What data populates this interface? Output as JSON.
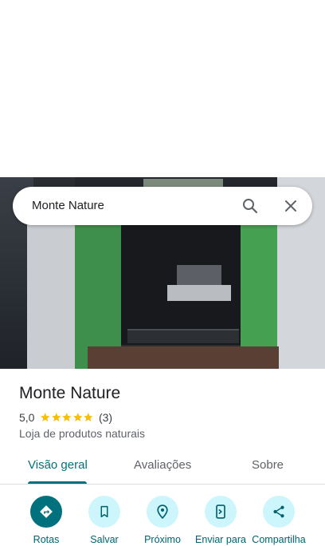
{
  "search": {
    "query": "Monte Nature"
  },
  "place": {
    "name": "Monte Nature",
    "rating": "5,0",
    "stars": 5,
    "review_count": "(3)",
    "category": "Loja de produtos naturais"
  },
  "tabs": [
    {
      "label": "Visão geral"
    },
    {
      "label": "Avaliações"
    },
    {
      "label": "Sobre"
    }
  ],
  "actions": [
    {
      "label": "Rotas",
      "icon": "directions-icon"
    },
    {
      "label": "Salvar",
      "icon": "bookmark-icon"
    },
    {
      "label": "Próximo",
      "icon": "nearby-pin-icon"
    },
    {
      "label": "Enviar para",
      "icon": "send-to-phone-icon"
    },
    {
      "label": "Compartilha",
      "icon": "share-icon"
    }
  ],
  "colors": {
    "accent": "#00717d",
    "action_bg": "#cdf5fc",
    "star": "#fbbc04"
  }
}
